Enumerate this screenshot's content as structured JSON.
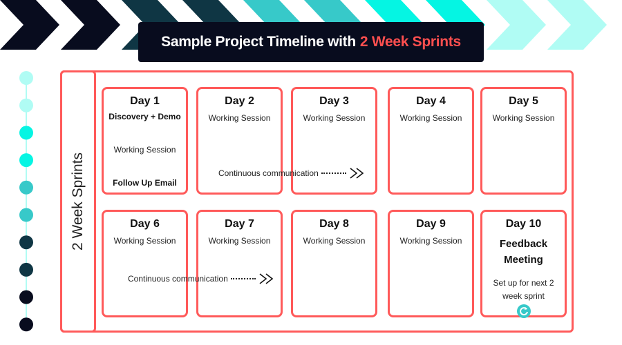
{
  "title": {
    "main": "Sample Project Timeline with",
    "highlight": "2 Week Sprints"
  },
  "colors": {
    "accent": "#ff5a5a",
    "chevrons": [
      "#080c1e",
      "#080c1e",
      "#0f3644",
      "#0f3644",
      "#37c9c9",
      "#37c9c9",
      "#05f5e3",
      "#05f5e3",
      "#b0fcf4",
      "#b0fcf4"
    ],
    "dots": [
      "#b0fcf4",
      "#b0fcf4",
      "#05f5e3",
      "#05f5e3",
      "#37c9c9",
      "#37c9c9",
      "#0f3644",
      "#0f3644",
      "#080c1e",
      "#080c1e"
    ]
  },
  "side_label": "2 Week Sprints",
  "days": [
    {
      "day": "Day 1",
      "bold1": "Discovery + Demo",
      "text": "Working Session",
      "bold2": "Follow Up Email"
    },
    {
      "day": "Day 2",
      "text": "Working Session"
    },
    {
      "day": "Day 3",
      "text": "Working Session"
    },
    {
      "day": "Day 4",
      "text": "Working Session"
    },
    {
      "day": "Day 5",
      "text": "Working Session"
    },
    {
      "day": "Day 6",
      "text": "Working Session"
    },
    {
      "day": "Day 7",
      "text": "Working Session"
    },
    {
      "day": "Day 8",
      "text": "Working Session"
    },
    {
      "day": "Day 9",
      "text": "Working Session"
    },
    {
      "day": "Day 10",
      "bold1": "Feedback Meeting",
      "text": "Set up for next 2 week sprint",
      "icon": "refresh-icon"
    }
  ],
  "communication": "Continuous communication"
}
